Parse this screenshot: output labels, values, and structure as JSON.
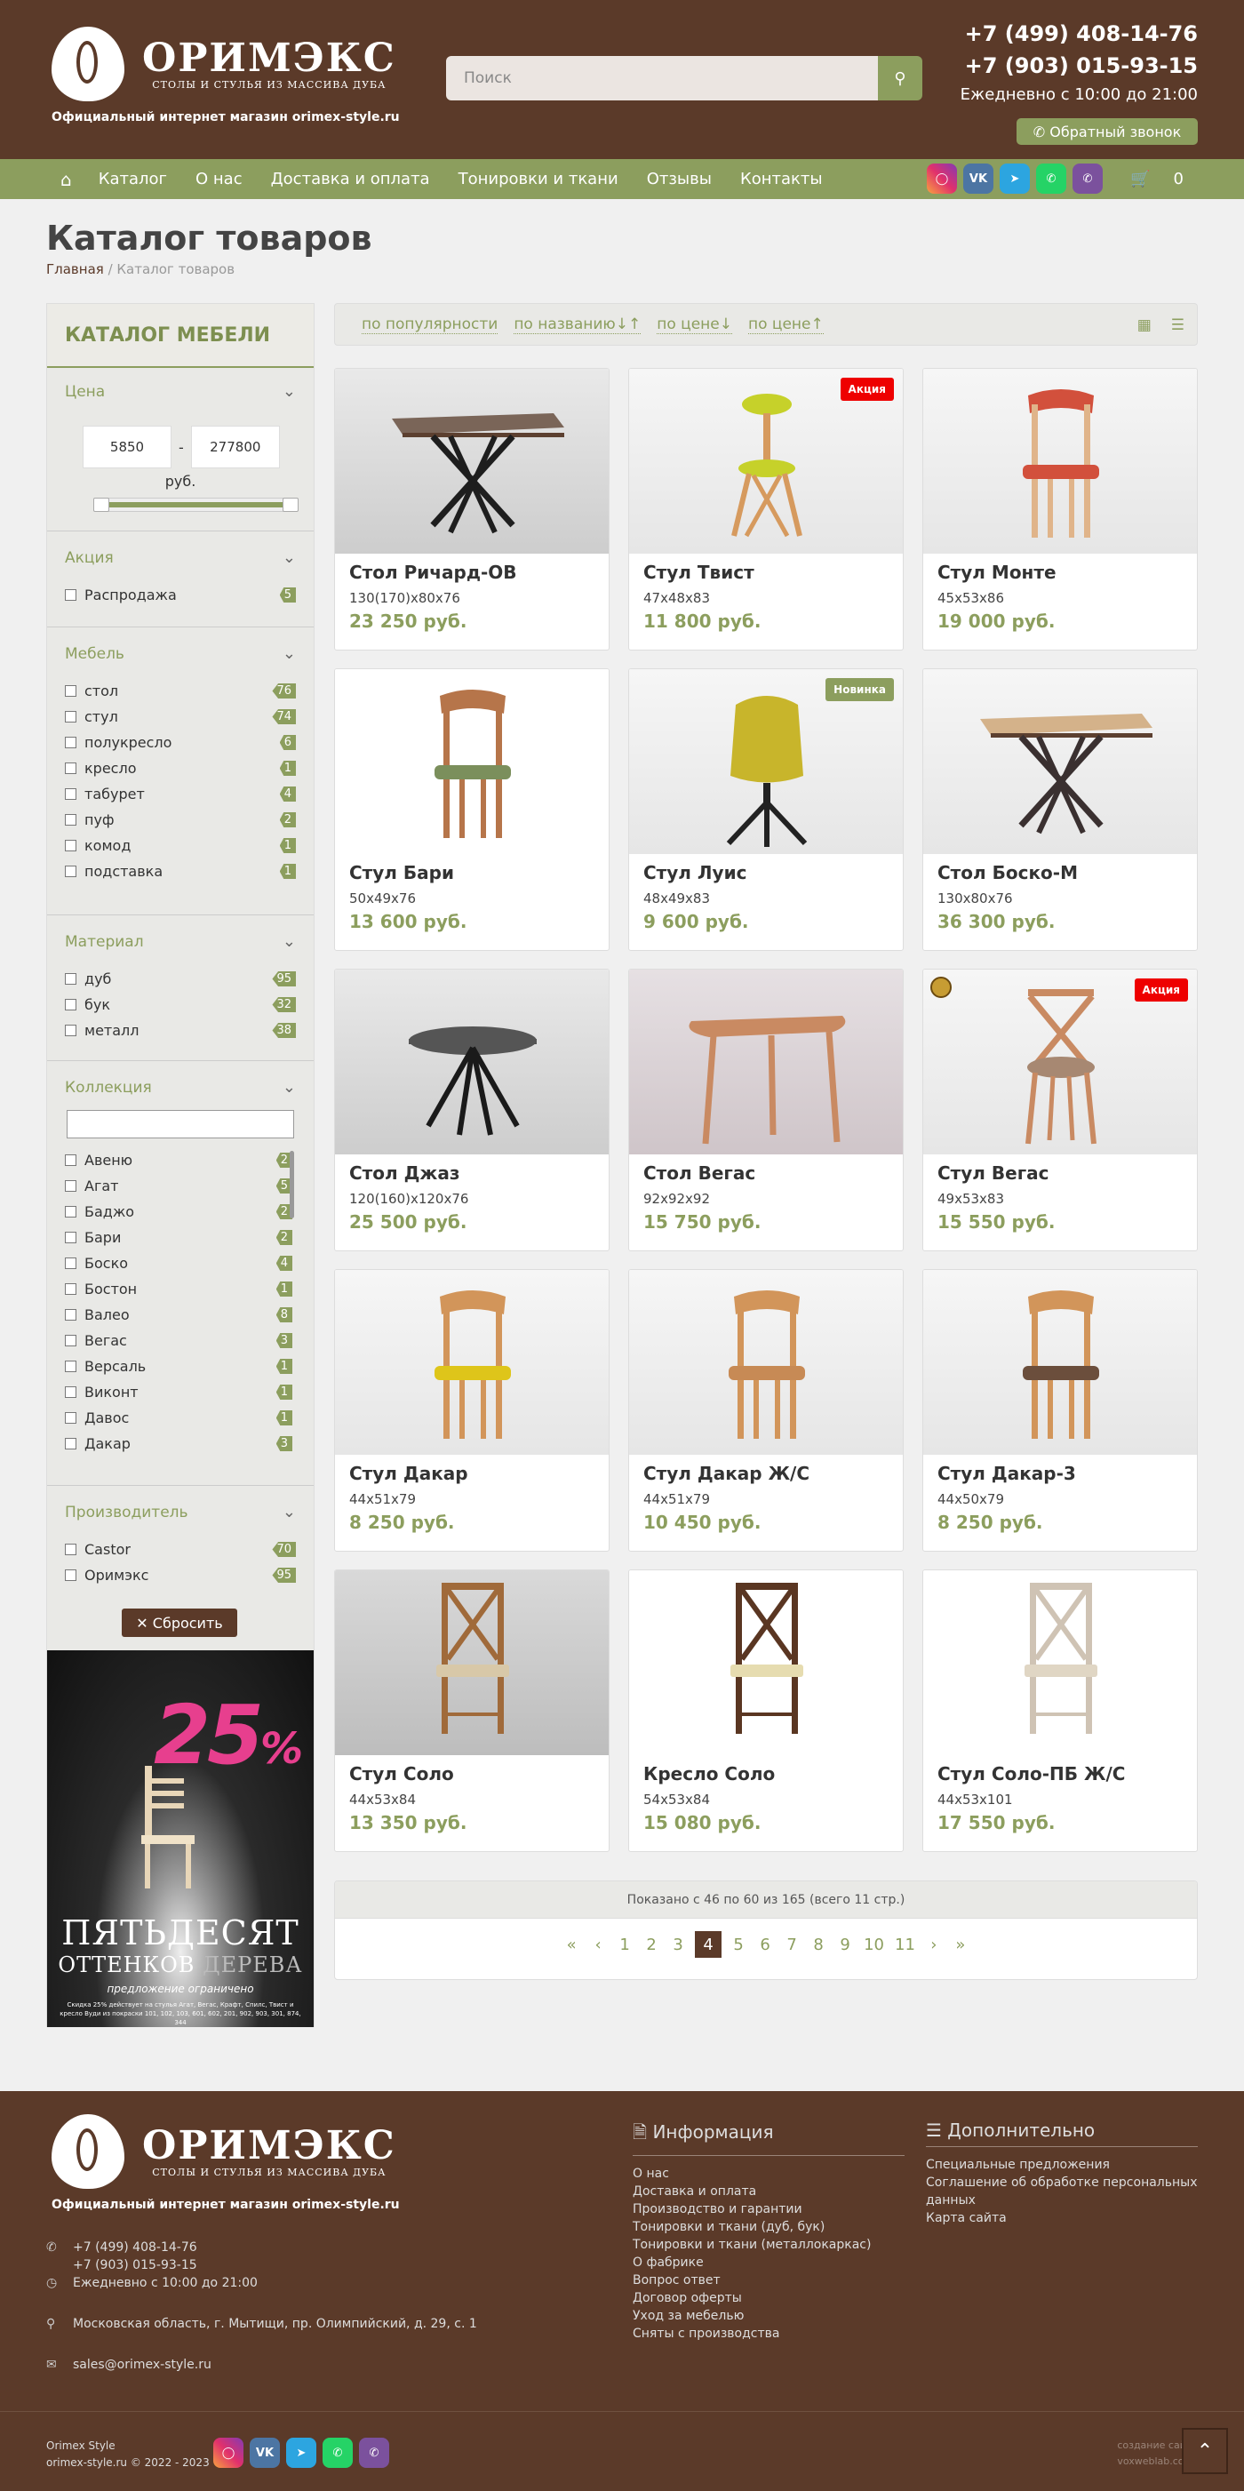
{
  "header": {
    "logo_name": "ОРИМЭКС",
    "logo_sub": "СТОЛЫ И СТУЛЬЯ ИЗ МАССИВА ДУБА",
    "tagline": "Официальный интернет магазин orimex-style.ru",
    "search_placeholder": "Поиск",
    "phone1": "+7 (499) 408-14-76",
    "phone2": "+7 (903) 015-93-15",
    "hours": "Ежедневно с 10:00 до 21:00",
    "callback": "Обратный звонок"
  },
  "nav": {
    "items": [
      "Каталог",
      "О нас",
      "Доставка и оплата",
      "Тонировки и ткани",
      "Отзывы",
      "Контакты"
    ],
    "social": [
      "instagram-icon",
      "vk-icon",
      "telegram-icon",
      "whatsapp-icon",
      "viber-icon"
    ],
    "cart_count": "0"
  },
  "page": {
    "title": "Каталог товаров",
    "crumb_home": "Главная",
    "crumb_current": "Каталог товаров"
  },
  "filters": {
    "heading": "КАТАЛОГ МЕБЕЛИ",
    "price_title": "Цена",
    "price_min": "5850",
    "price_max": "277800",
    "price_unit": "руб.",
    "price_range_fraction": [
      0.0,
      1.0
    ],
    "sale_title": "Акция",
    "sale": [
      {
        "label": "Распродажа",
        "count": "5"
      }
    ],
    "furniture_title": "Мебель",
    "furniture": [
      {
        "label": "стол",
        "count": "76"
      },
      {
        "label": "стул",
        "count": "74"
      },
      {
        "label": "полукресло",
        "count": "6"
      },
      {
        "label": "кресло",
        "count": "1"
      },
      {
        "label": "табурет",
        "count": "4"
      },
      {
        "label": "пуф",
        "count": "2"
      },
      {
        "label": "комод",
        "count": "1"
      },
      {
        "label": "подставка",
        "count": "1"
      }
    ],
    "material_title": "Материал",
    "material": [
      {
        "label": "дуб",
        "count": "95"
      },
      {
        "label": "бук",
        "count": "32"
      },
      {
        "label": "металл",
        "count": "38"
      }
    ],
    "collection_title": "Коллекция",
    "collection_search": "",
    "collection": [
      {
        "label": "Авеню",
        "count": "2"
      },
      {
        "label": "Агат",
        "count": "5"
      },
      {
        "label": "Баджо",
        "count": "2"
      },
      {
        "label": "Бари",
        "count": "2"
      },
      {
        "label": "Боско",
        "count": "4"
      },
      {
        "label": "Бостон",
        "count": "1"
      },
      {
        "label": "Валео",
        "count": "8"
      },
      {
        "label": "Вегас",
        "count": "3"
      },
      {
        "label": "Версаль",
        "count": "1"
      },
      {
        "label": "Виконт",
        "count": "1"
      },
      {
        "label": "Давос",
        "count": "1"
      },
      {
        "label": "Дакар",
        "count": "3"
      }
    ],
    "maker_title": "Производитель",
    "maker": [
      {
        "label": "Castor",
        "count": "70"
      },
      {
        "label": "Оримэкс",
        "count": "95"
      }
    ],
    "reset": "✕ Сбросить"
  },
  "promo": {
    "pct": "25",
    "pct_sign": "%",
    "line1": "ПЯТЬДЕСЯТ",
    "line2a": "ОТТЕНКОВ",
    "line2b": "ДЕРЕВА",
    "line3": "предложение ограничено",
    "line4": "Скидка 25% действует на стулья Агат, Вегас, Крафт, Спилс, Твист и кресло Вуди из покраски 101, 102, 103, 601, 602, 201, 902, 903, 301, 874, 344"
  },
  "sort": {
    "items": [
      "по популярности",
      "по названию↓↑",
      "по цене↓",
      "по цене↑"
    ]
  },
  "products": [
    {
      "name": "Стол Ричард-ОВ",
      "dim": "130(170)х80х76",
      "price": "23 250 руб.",
      "badge": ""
    },
    {
      "name": "Стул Твист",
      "dim": "47х48х83",
      "price": "11 800 руб.",
      "badge": "Акция"
    },
    {
      "name": "Стул Монте",
      "dim": "45х53х86",
      "price": "19 000 руб.",
      "badge": ""
    },
    {
      "name": "Стул Бари",
      "dim": "50х49х76",
      "price": "13 600 руб.",
      "badge": ""
    },
    {
      "name": "Стул Луис",
      "dim": "48х49х83",
      "price": "9 600 руб.",
      "badge": "Новинка"
    },
    {
      "name": "Стол Боско-М",
      "dim": "130х80х76",
      "price": "36 300 руб.",
      "badge": ""
    },
    {
      "name": "Стол Джаз",
      "dim": "120(160)х120х76",
      "price": "25 500 руб.",
      "badge": ""
    },
    {
      "name": "Стол Вегас",
      "dim": "92х92х92",
      "price": "15 750 руб.",
      "badge": ""
    },
    {
      "name": "Стул Вегас",
      "dim": "49х53х83",
      "price": "15 550 руб.",
      "badge": "Акция"
    },
    {
      "name": "Стул Дакар",
      "dim": "44х51х79",
      "price": "8 250 руб.",
      "badge": ""
    },
    {
      "name": "Стул Дакар Ж/С",
      "dim": "44х51х79",
      "price": "10 450 руб.",
      "badge": ""
    },
    {
      "name": "Стул Дакар-3",
      "dim": "44х50х79",
      "price": "8 250 руб.",
      "badge": ""
    },
    {
      "name": "Стул Соло",
      "dim": "44х53х84",
      "price": "13 350 руб.",
      "badge": ""
    },
    {
      "name": "Кресло Соло",
      "dim": "54х53х84",
      "price": "15 080 руб.",
      "badge": ""
    },
    {
      "name": "Стул Соло-ПБ Ж/С",
      "dim": "44х53х101",
      "price": "17 550 руб.",
      "badge": ""
    }
  ],
  "pagination": {
    "info": "Показано с 46 по 60 из 165 (всего 11 стр.)",
    "first": "«",
    "prev": "‹",
    "pages": [
      "1",
      "2",
      "3",
      "4",
      "5",
      "6",
      "7",
      "8",
      "9",
      "10",
      "11"
    ],
    "current": "4",
    "next": "›",
    "last": "»"
  },
  "footer": {
    "tagline": "Официальный интернет магазин orimex-style.ru",
    "phone1": "+7 (499) 408-14-76",
    "phone2": "+7 (903) 015-93-15",
    "hours": "Ежедневно с 10:00 до 21:00",
    "address": "Московская область, г. Мытищи, пр. Олимпийский, д. 29, с. 1",
    "email": "sales@orimex-style.ru",
    "info_title": "Информация",
    "info_links": [
      "О нас",
      "Доставка и оплата",
      "Производство и гарантии",
      "Тонировки и ткани (дуб, бук)",
      "Тонировки и ткани (металлокаркас)",
      "О фабрике",
      "Вопрос ответ",
      "Договор оферты",
      "Уход за мебелью",
      "Сняты с производства"
    ],
    "extra_title": "Дополнительно",
    "extra_links": [
      "Специальные предложения",
      "Соглашение об обработке персональных данных",
      "Карта сайта"
    ],
    "copy1": "Orimex Style",
    "copy2": "orimex-style.ru © 2022 - 2023",
    "dev1": "создание сайта",
    "dev2": "voxweblab.com"
  },
  "colors": {
    "brown": "#5b3a29",
    "olive": "#8c9e5e",
    "sale_red": "#ee0000"
  }
}
